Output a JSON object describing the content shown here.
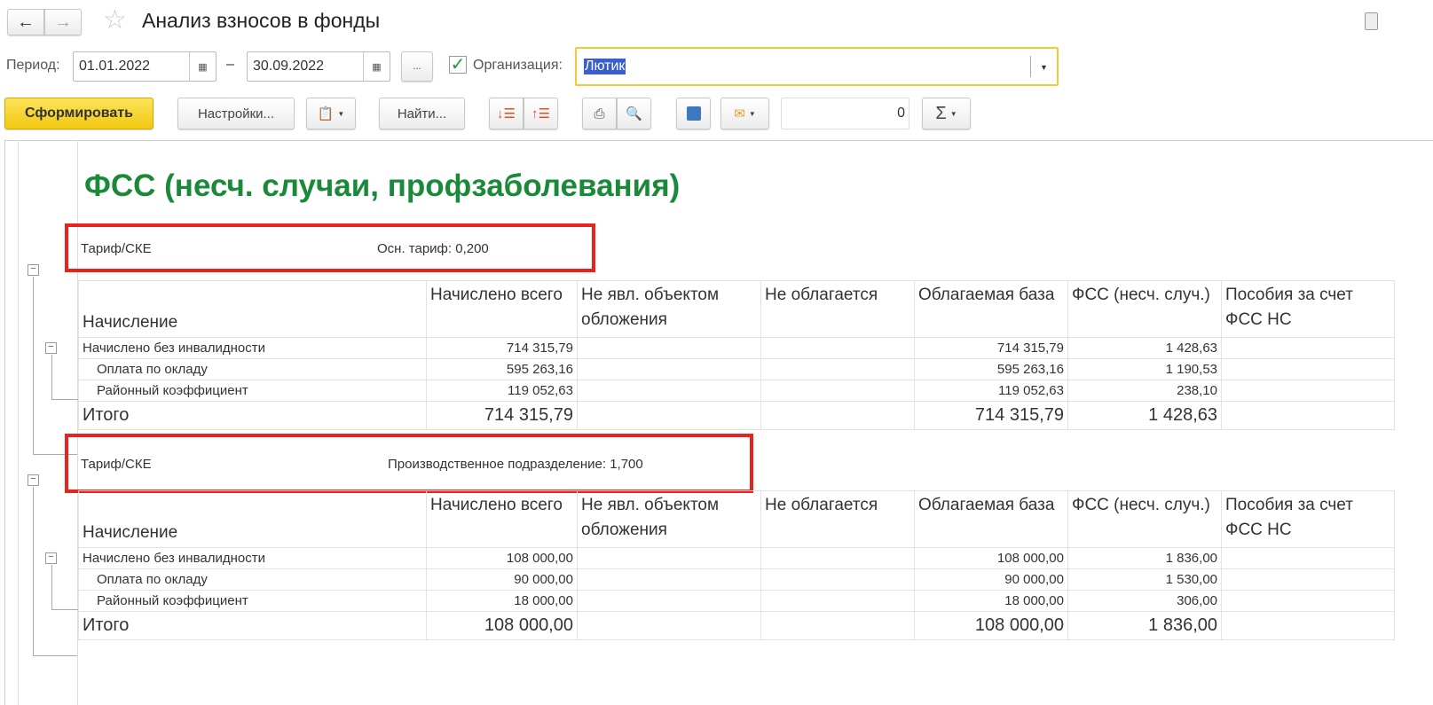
{
  "header": {
    "title": "Анализ взносов в фонды",
    "back_icon": "arrow-left",
    "forward_icon": "arrow-right"
  },
  "filters": {
    "period_label": "Период:",
    "date_from": "01.01.2022",
    "dash": "–",
    "date_to": "30.09.2022",
    "more": "...",
    "org_checked": true,
    "org_label": "Организация:",
    "org_value": "Лютик"
  },
  "toolbar": {
    "generate": "Сформировать",
    "settings": "Настройки...",
    "find": "Найти...",
    "counter": "0",
    "sum": "Σ"
  },
  "report": {
    "title": "ФСС (несч. случаи, профзаболевания)",
    "columns": [
      "Начисление",
      "Начислено всего",
      "Не явл. объектом обложения",
      "Не облагается",
      "Облагаемая база",
      "ФСС (несч. случ.)",
      "Пособия за счет ФСС НС"
    ],
    "sections": [
      {
        "tarif_label": "Тариф/СКЕ",
        "tarif_value": "Осн. тариф: 0,200",
        "rows": [
          {
            "name": "Начислено без инвалидности",
            "total": "714 315,79",
            "nonobj": "",
            "exempt": "",
            "base": "714 315,79",
            "fss": "1 428,63",
            "benefits": ""
          },
          {
            "name": "Оплата по окладу",
            "total": "595 263,16",
            "nonobj": "",
            "exempt": "",
            "base": "595 263,16",
            "fss": "1 190,53",
            "benefits": ""
          },
          {
            "name": "Районный коэффициент",
            "total": "119 052,63",
            "nonobj": "",
            "exempt": "",
            "base": "119 052,63",
            "fss": "238,10",
            "benefits": ""
          }
        ],
        "itogo": {
          "name": "Итого",
          "total": "714 315,79",
          "nonobj": "",
          "exempt": "",
          "base": "714 315,79",
          "fss": "1 428,63",
          "benefits": ""
        }
      },
      {
        "tarif_label": "Тариф/СКЕ",
        "tarif_value": "Производственное подразделение: 1,700",
        "rows": [
          {
            "name": "Начислено без инвалидности",
            "total": "108 000,00",
            "nonobj": "",
            "exempt": "",
            "base": "108 000,00",
            "fss": "1 836,00",
            "benefits": ""
          },
          {
            "name": "Оплата по окладу",
            "total": "90 000,00",
            "nonobj": "",
            "exempt": "",
            "base": "90 000,00",
            "fss": "1 530,00",
            "benefits": ""
          },
          {
            "name": "Районный коэффициент",
            "total": "18 000,00",
            "nonobj": "",
            "exempt": "",
            "base": "18 000,00",
            "fss": "306,00",
            "benefits": ""
          }
        ],
        "itogo": {
          "name": "Итого",
          "total": "108 000,00",
          "nonobj": "",
          "exempt": "",
          "base": "108 000,00",
          "fss": "1 836,00",
          "benefits": ""
        }
      }
    ]
  }
}
